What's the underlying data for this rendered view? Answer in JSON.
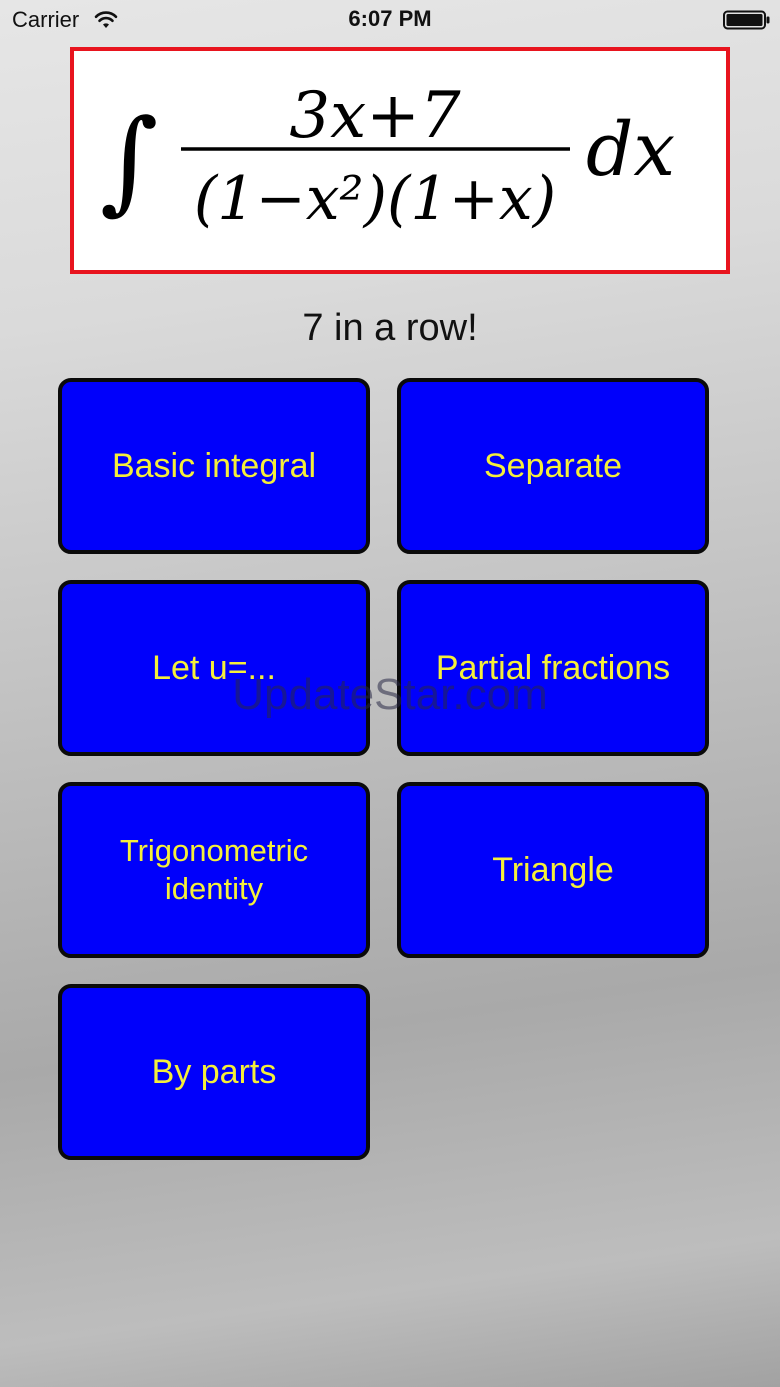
{
  "status_bar": {
    "carrier": "Carrier",
    "time": "6:07 PM",
    "wifi_icon": "wifi-icon",
    "battery_icon": "battery-icon"
  },
  "formula": {
    "integral_sign": "∫",
    "numerator": "3x+7",
    "denominator": "(1−x²)(1+x)",
    "differential": "dx",
    "border_color": "#e8141e"
  },
  "streak_label": "7 in a row!",
  "methods": [
    "Basic integral",
    "Separate",
    "Let u=...",
    "Partial fractions",
    "Trigonometric identity",
    "Triangle",
    "By parts"
  ],
  "colors": {
    "button_bg": "#0000fb",
    "button_text": "#f5ef3a",
    "button_border": "#0a0a0a"
  },
  "watermark": "UpdateStar.com"
}
